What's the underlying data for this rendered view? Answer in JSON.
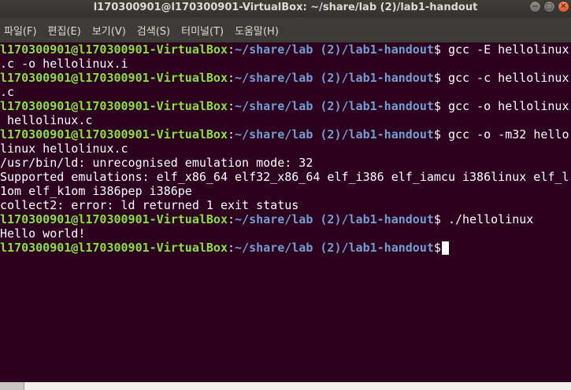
{
  "window": {
    "title": "l170300901@l170300901-VirtualBox: ~/share/lab (2)/lab1-handout",
    "minimize_symbol": "−",
    "maximize_symbol": "□",
    "close_symbol": "✕"
  },
  "menu": [
    {
      "label": "파일(F)"
    },
    {
      "label": "편집(E)"
    },
    {
      "label": "보기(V)"
    },
    {
      "label": "검색(S)"
    },
    {
      "label": "터미널(T)"
    },
    {
      "label": "도움말(H)"
    }
  ],
  "terminal": {
    "user_host": "l170300901@l170300901-VirtualBox",
    "path": "~/share/lab (2)/lab1-handout",
    "lines": [
      {
        "kind": "prompt",
        "cmd": " gcc -E hellolinux"
      },
      {
        "kind": "text",
        "text": ".c -o hellolinux.i"
      },
      {
        "kind": "prompt",
        "cmd": " gcc -c hellolinux"
      },
      {
        "kind": "text",
        "text": ".c"
      },
      {
        "kind": "prompt",
        "cmd": " gcc -o hellolinux"
      },
      {
        "kind": "text",
        "text": " hellolinux.c"
      },
      {
        "kind": "prompt",
        "cmd": " gcc -o -m32 hello"
      },
      {
        "kind": "text",
        "text": "linux hellolinux.c"
      },
      {
        "kind": "text",
        "text": "/usr/bin/ld: unrecognised emulation mode: 32"
      },
      {
        "kind": "text",
        "text": "Supported emulations: elf_x86_64 elf32_x86_64 elf_i386 elf_iamcu i386linux elf_l"
      },
      {
        "kind": "text",
        "text": "1om elf_k1om i386pep i386pe"
      },
      {
        "kind": "text",
        "text": "collect2: error: ld returned 1 exit status"
      },
      {
        "kind": "prompt",
        "cmd": " ./hellolinux"
      },
      {
        "kind": "text",
        "text": "Hello world!"
      },
      {
        "kind": "prompt",
        "cmd": "",
        "cursor": true
      }
    ]
  },
  "colors": {
    "background": "#2c001e",
    "user_host": "#8ae234",
    "path": "#729fcf",
    "text": "#ffffff"
  }
}
